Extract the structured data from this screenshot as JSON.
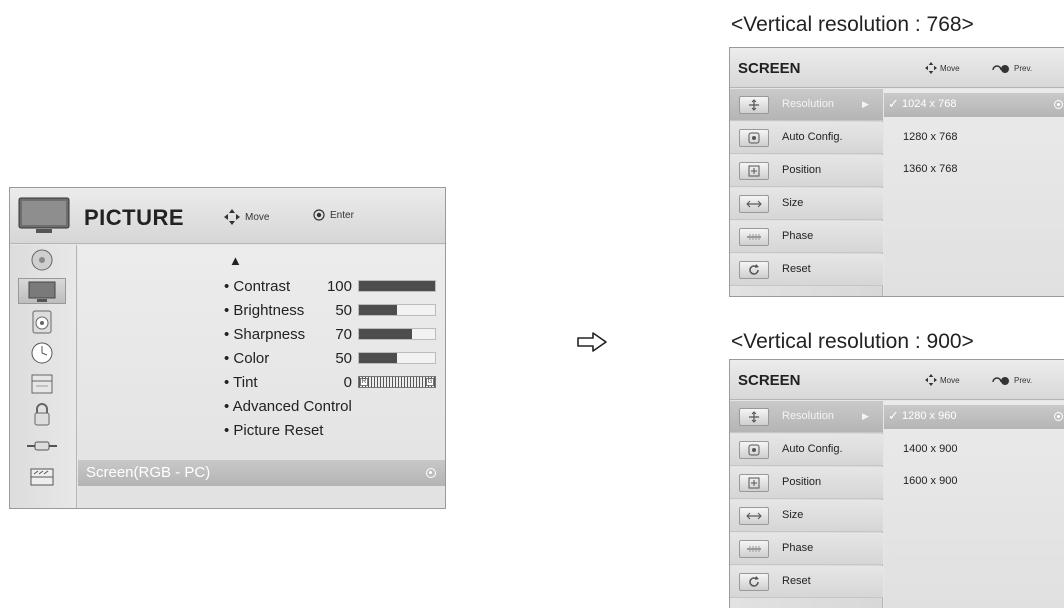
{
  "picture_menu": {
    "title": "PICTURE",
    "hint_move": "Move",
    "hint_enter": "Enter",
    "up_arrow": "▲",
    "sidebar_icons": [
      "disc-icon",
      "tv-icon",
      "speaker-icon",
      "clock-icon",
      "lock-settings-icon",
      "padlock-icon",
      "input-plug-icon",
      "usb-icon"
    ],
    "selected_sidebar_index": 1,
    "items": [
      {
        "label": "• Contrast",
        "value": "100",
        "level": 100
      },
      {
        "label": "• Brightness",
        "value": "50",
        "level": 50
      },
      {
        "label": "• Sharpness",
        "value": "70",
        "level": 70
      },
      {
        "label": "• Color",
        "value": "50",
        "level": 50
      },
      {
        "label": "• Tint",
        "value": "0",
        "tint_left": "R",
        "tint_right": "G"
      },
      {
        "label": "• Advanced Control"
      },
      {
        "label": "• Picture Reset"
      }
    ],
    "highlighted_item": "Screen(RGB - PC)"
  },
  "panel_768": {
    "caption": "<Vertical resolution : 768>",
    "title": "SCREEN",
    "hint_move": "Move",
    "hint_prev": "Prev.",
    "menu_items": [
      "Resolution",
      "Auto Config.",
      "Position",
      "Size",
      "Phase",
      "Reset"
    ],
    "options": [
      "1024 x 768",
      "1280 x 768",
      "1360 x 768"
    ],
    "selected_option": "1024 x 768"
  },
  "panel_900": {
    "caption": "<Vertical resolution : 900>",
    "title": "SCREEN",
    "hint_move": "Move",
    "hint_prev": "Prev.",
    "menu_items": [
      "Resolution",
      "Auto Config.",
      "Position",
      "Size",
      "Phase",
      "Reset"
    ],
    "options": [
      "1280 x 960",
      "1400 x 900",
      "1600 x 900"
    ],
    "selected_option": "1280 x 960"
  },
  "colors": {
    "bar_fill": "#4d4d4d",
    "selected_bg": "#bcbcbc",
    "panel_bg": "#e6e6e6"
  }
}
